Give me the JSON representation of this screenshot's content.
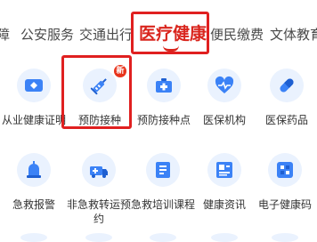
{
  "tabs": [
    {
      "label": "障"
    },
    {
      "label": "公安服务"
    },
    {
      "label": "交通出行"
    },
    {
      "label": "医疗健康",
      "active": true
    },
    {
      "label": "便民缴费"
    },
    {
      "label": "文体教育"
    }
  ],
  "row1": [
    {
      "label": "从业健康证明",
      "icon": "id-card-icon"
    },
    {
      "label": "预防接种",
      "icon": "syringe-icon",
      "badge": "新"
    },
    {
      "label": "预防接种点",
      "icon": "medical-kit-icon"
    },
    {
      "label": "医保机构",
      "icon": "heart-pulse-icon"
    },
    {
      "label": "医保药品",
      "icon": "pill-icon"
    }
  ],
  "row2": [
    {
      "label": "急救报警",
      "icon": "siren-icon"
    },
    {
      "label": "非急救转运预约",
      "icon": "ambulance-icon"
    },
    {
      "label": "急救培训课程",
      "icon": "book-icon"
    },
    {
      "label": "健康资讯",
      "icon": "news-icon"
    },
    {
      "label": "电子健康码",
      "icon": "qr-code-icon"
    }
  ],
  "colors": {
    "accent": "#d9251d",
    "icon_bg": "#eaf2fe",
    "icon_blue": "#3b82f6",
    "icon_dark": "#1e5fd1"
  }
}
